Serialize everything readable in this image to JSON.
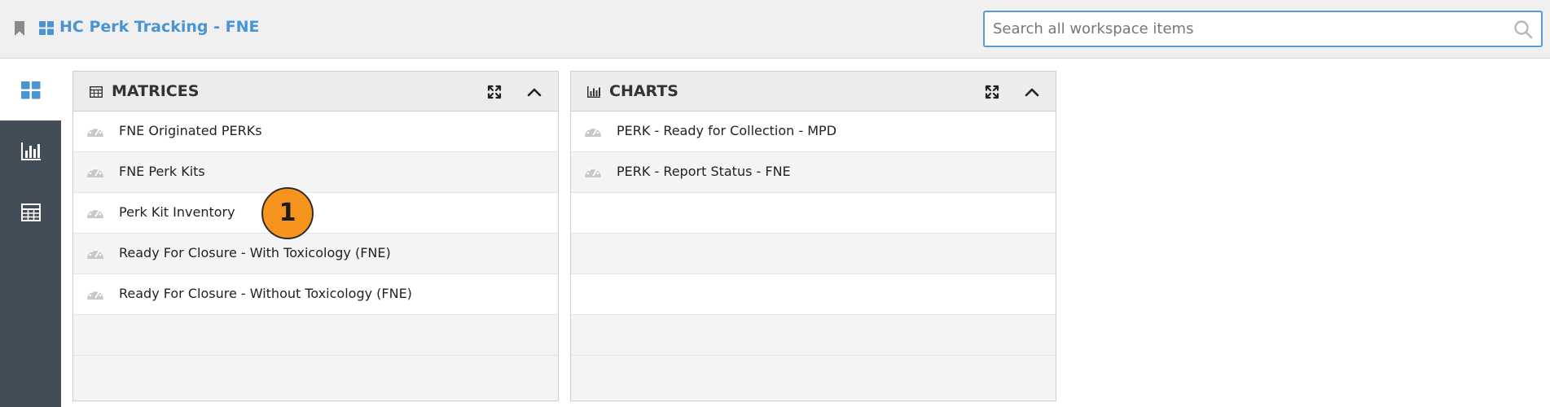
{
  "header": {
    "title": "HC Perk Tracking - FNE",
    "icons": {
      "bookmark": "bookmark-icon",
      "workspace": "dashboard-grid-icon"
    }
  },
  "search": {
    "placeholder": "Search all workspace items",
    "value": "",
    "icon": "search-icon"
  },
  "sidebar": {
    "items": [
      {
        "icon": "dashboard-grid-icon",
        "active": true
      },
      {
        "icon": "bar-chart-icon",
        "active": false
      },
      {
        "icon": "table-icon",
        "active": false
      }
    ]
  },
  "panels": {
    "matrices": {
      "title": "MATRICES",
      "icon": "table-icon",
      "items": [
        "FNE Originated PERKs",
        "FNE Perk Kits",
        "Perk Kit Inventory",
        "Ready For Closure - With Toxicology (FNE)",
        "Ready For Closure - Without Toxicology (FNE)"
      ]
    },
    "charts": {
      "title": "CHARTS",
      "icon": "bar-chart-icon",
      "items": [
        "PERK - Ready for Collection - MPD",
        "PERK - Report Status - FNE"
      ]
    }
  },
  "callout": {
    "label": "1",
    "color": "#f7941d"
  },
  "colors": {
    "accent": "#4a94d2",
    "sidebar": "#434d57",
    "search_border": "#5b9bd5",
    "topbar": "#f0f0f0"
  }
}
